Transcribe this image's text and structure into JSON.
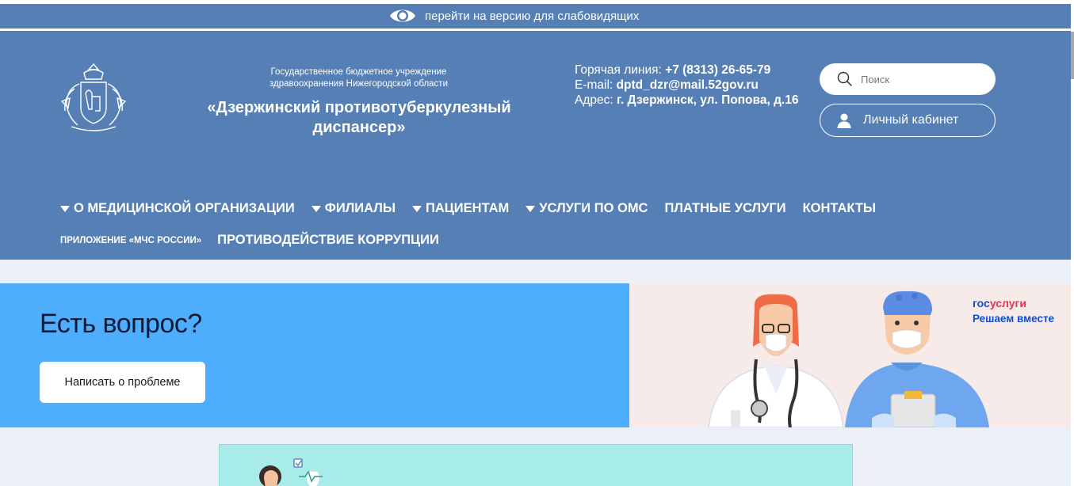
{
  "accessibility": {
    "link_label": "перейти на версию для слабовидящих",
    "icon": "eye-icon"
  },
  "header": {
    "emblem": "nizhny-novgorod-coat-of-arms",
    "org_subtitle": "Государственное бюджетное учреждение здравоохранения Нижегородской области",
    "org_name": "«Дзержинский противотуберкулезный диспансер»",
    "hotline_label": "Горячая линия:",
    "hotline_value": "+7 (8313) 26-65-79",
    "email_label": "E-mail:",
    "email_value": "dptd_dzr@mail.52gov.ru",
    "address_label": "Адрес:",
    "address_value": "г. Дзержинск, ул. Попова, д.16",
    "search": {
      "placeholder": "Поиск",
      "value": "",
      "icon": "search-icon"
    },
    "cabinet_label": "Личный кабинет"
  },
  "nav": {
    "row1": [
      {
        "label": "О МЕДИЦИНСКОЙ ОРГАНИЗАЦИИ",
        "dropdown": true
      },
      {
        "label": "ФИЛИАЛЫ",
        "dropdown": true
      },
      {
        "label": "ПАЦИЕНТАМ",
        "dropdown": true
      },
      {
        "label": "УСЛУГИ ПО ОМС",
        "dropdown": true
      },
      {
        "label": "ПЛАТНЫЕ УСЛУГИ",
        "dropdown": false
      },
      {
        "label": "КОНТАКТЫ",
        "dropdown": false
      }
    ],
    "row2": [
      {
        "label": "ПРИЛОЖЕНИЕ «МЧС РОССИИ»"
      },
      {
        "label": "ПРОТИВОДЕЙСТВИЕ КОРРУПЦИИ"
      }
    ]
  },
  "banner": {
    "title": "Есть вопрос?",
    "button_label": "Написать о проблеме",
    "gosuslugi_part1": "гос",
    "gosuslugi_part2": "услуги",
    "gosuslugi_tagline": "Решаем вместе"
  },
  "colors": {
    "header_bg": "#557fb5",
    "banner_blue": "#4eaefd",
    "banner_peach": "#f6ebe8",
    "page_bg": "#ebeff7",
    "teaser_bg": "#a7ece8"
  }
}
